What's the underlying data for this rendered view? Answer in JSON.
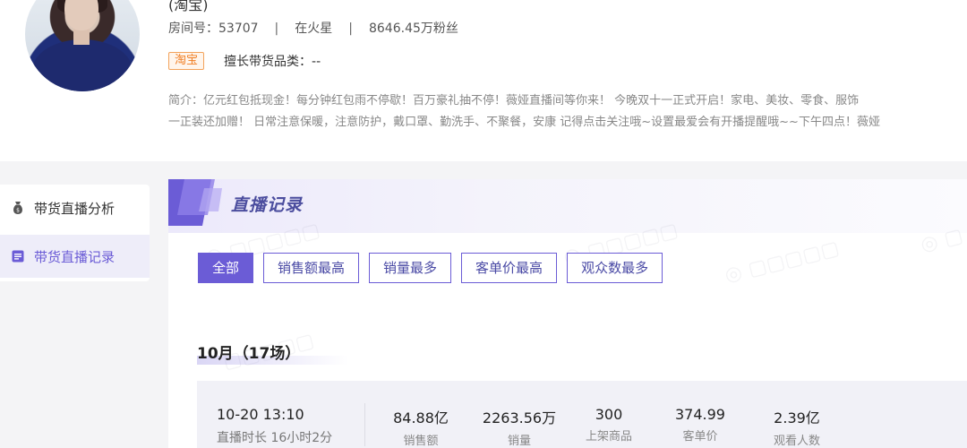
{
  "profile": {
    "name_partial": "(淘宝)",
    "room_label": "房间号：53707",
    "location": "在火星",
    "fans": "8646.45万粉丝",
    "platform_badge": "淘宝",
    "category_label": "擅长带货品类：--",
    "desc_line1": "简介：亿元红包抵现金！每分钟红包雨不停歇！百万豪礼抽不停！薇娅直播间等你来！ 今晚双十一正式开启！家电、美妆、零食、服饰",
    "desc_line2": "一正装还加赠！ 日常注意保暖，注意防护，戴口罩、勤洗手、不聚餐，安康 记得点击关注哦~设置最爱会有开播提醒哦~~下午四点！薇娅"
  },
  "nav": {
    "items": [
      {
        "label": "带货直播分析",
        "icon": "money-bag-icon"
      },
      {
        "label": "带货直播记录",
        "icon": "list-icon"
      }
    ]
  },
  "main": {
    "title": "直播记录",
    "filters": [
      "全部",
      "销售额最高",
      "销量最多",
      "客单价最高",
      "观众数最多"
    ],
    "month_header": "10月（17场）",
    "record": {
      "time": "10-20 13:10",
      "duration": "直播时长 16小时2分",
      "stats": [
        {
          "value": "84.88亿",
          "label": "销售额"
        },
        {
          "value": "2263.56万",
          "label": "销量"
        },
        {
          "value": "300",
          "label": "上架商品"
        },
        {
          "value": "374.99",
          "label": "客单价"
        },
        {
          "value": "2.39亿",
          "label": "观看人数"
        }
      ]
    }
  },
  "colors": {
    "accent": "#6b5cd6",
    "badge_orange": "#f07d21"
  }
}
